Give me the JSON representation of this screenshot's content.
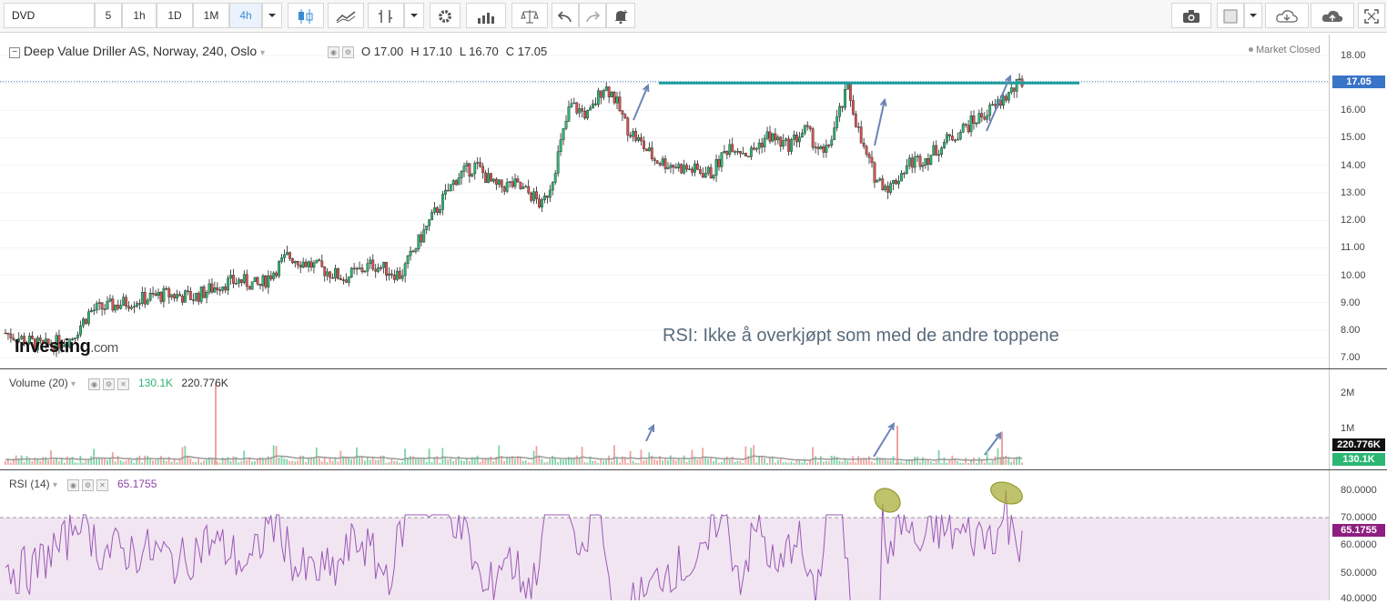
{
  "toolbar": {
    "symbol": "DVD",
    "intervals": [
      "5",
      "1h",
      "1D",
      "1M",
      "4h"
    ],
    "active_interval": "4h",
    "icons": [
      "chevron-down-icon",
      "candlestick-icon",
      "line-chart-icon",
      "bar-style-icon",
      "chevron-down-icon",
      "gear-icon",
      "volume-bars-icon",
      "scale-icon",
      "undo-icon",
      "redo-icon",
      "alert-bell-icon",
      "camera-icon",
      "color-square-icon",
      "chevron-down-icon",
      "cloud-download-icon",
      "cloud-upload-icon",
      "fullscreen-icon"
    ]
  },
  "header": {
    "title": "Deep Value Driller AS, Norway, 240, Oslo",
    "open": "O 17.00",
    "high": "H 17.10",
    "low": "L 16.70",
    "close": "C 17.05",
    "status": "Market Closed"
  },
  "annotation": "RSI: Ikke å overkjøpt som med de andre toppene",
  "logo": {
    "main": "Investing",
    "suffix": ".com"
  },
  "volume_panel": {
    "label": "Volume (20)",
    "value1": "130.1K",
    "value2": "220.776K"
  },
  "rsi_panel": {
    "label": "RSI (14)",
    "value": "65.1755"
  },
  "price_axis": {
    "ticks": [
      "18.00",
      "17.00",
      "16.00",
      "15.00",
      "14.00",
      "13.00",
      "12.00",
      "11.00",
      "10.00",
      "9.00",
      "8.00",
      "7.00"
    ],
    "current_tag": "17.05"
  },
  "volume_axis": {
    "ticks": [
      "2M",
      "1M"
    ],
    "tag_ma": "220.776K",
    "tag_vol": "130.1K"
  },
  "rsi_axis": {
    "ticks": [
      "80.0000",
      "70.0000",
      "60.0000",
      "50.0000",
      "40.0000"
    ],
    "current_tag": "65.1755"
  },
  "colors": {
    "up": "#2bb673",
    "down": "#d9534f",
    "resistance": "#1a9c9c",
    "arrow": "#6b84b8",
    "rsi_line": "#9b59b6",
    "rsi_band": "#f1e5f2",
    "ellipse": "#a8ad38"
  },
  "chart_data": {
    "type": "candlestick",
    "title": "Deep Value Driller AS, Norway, 240, Oslo",
    "ylim": [
      7.0,
      18.0
    ],
    "resistance_level": 17.0,
    "last": {
      "open": 17.0,
      "high": 17.1,
      "low": 16.7,
      "close": 17.05
    },
    "price_path": [
      [
        0,
        7.9
      ],
      [
        0.04,
        7.4
      ],
      [
        0.07,
        7.7
      ],
      [
        0.09,
        8.7
      ],
      [
        0.14,
        9.1
      ],
      [
        0.17,
        9.3
      ],
      [
        0.2,
        9.2
      ],
      [
        0.23,
        9.7
      ],
      [
        0.25,
        9.8
      ],
      [
        0.27,
        9.6
      ],
      [
        0.3,
        10.7
      ],
      [
        0.33,
        10.3
      ],
      [
        0.36,
        9.9
      ],
      [
        0.39,
        10.4
      ],
      [
        0.42,
        10.0
      ],
      [
        0.44,
        11.3
      ],
      [
        0.46,
        12.5
      ],
      [
        0.48,
        13.6
      ],
      [
        0.5,
        14.0
      ],
      [
        0.52,
        13.2
      ],
      [
        0.54,
        13.3
      ],
      [
        0.56,
        12.9
      ],
      [
        0.57,
        12.5
      ],
      [
        0.58,
        13.4
      ],
      [
        0.6,
        16.2
      ],
      [
        0.62,
        15.8
      ],
      [
        0.635,
        16.9
      ],
      [
        0.645,
        16.6
      ],
      [
        0.66,
        15.4
      ],
      [
        0.69,
        14.2
      ],
      [
        0.72,
        13.9
      ],
      [
        0.75,
        13.7
      ],
      [
        0.77,
        14.8
      ],
      [
        0.79,
        14.4
      ],
      [
        0.81,
        15.1
      ],
      [
        0.83,
        14.7
      ],
      [
        0.85,
        15.3
      ],
      [
        0.87,
        14.3
      ],
      [
        0.895,
        16.8
      ],
      [
        0.91,
        14.7
      ],
      [
        0.925,
        13.5
      ],
      [
        0.94,
        13.2
      ],
      [
        0.96,
        14.1
      ],
      [
        0.98,
        14.3
      ],
      [
        1.0,
        14.9
      ],
      [
        1.02,
        15.4
      ],
      [
        1.05,
        16.1
      ],
      [
        1.08,
        17.05
      ]
    ],
    "volume": {
      "ylim": [
        0,
        2.2
      ],
      "unit": "M",
      "last": 130100,
      "ma20": 220776,
      "spikes": [
        2.3,
        1.1,
        0.92
      ]
    },
    "rsi": {
      "ylim": [
        40,
        85
      ],
      "overbought": 70,
      "last": 65.1755
    }
  }
}
